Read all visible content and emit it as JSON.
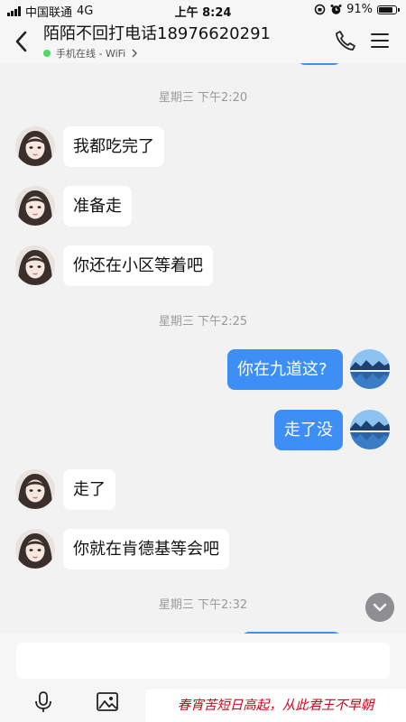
{
  "status_bar": {
    "carrier": "中国联通",
    "network": "4G",
    "time": "上午 8:24",
    "battery": "91%",
    "battery_level": 0.91
  },
  "header": {
    "title": "陌陌不回打电话18976620291",
    "presence": "手机在线 - WiFi"
  },
  "messages": [
    {
      "type": "time",
      "text": "星期三 下午2:20"
    },
    {
      "type": "in",
      "text": "我都吃完了"
    },
    {
      "type": "in",
      "text": "准备走"
    },
    {
      "type": "in",
      "text": "你还在小区等着吧"
    },
    {
      "type": "time",
      "text": "星期三 下午2:25"
    },
    {
      "type": "out",
      "text": "你在九道这?"
    },
    {
      "type": "out",
      "text": "走了没"
    },
    {
      "type": "in",
      "text": "走了"
    },
    {
      "type": "in",
      "text": "你就在肯德基等会吧"
    },
    {
      "type": "time",
      "text": "星期三 下午2:32"
    }
  ],
  "input": {
    "placeholder": ""
  },
  "banner": {
    "text": "春宵苦短日高起，从此君王不早朝"
  },
  "colors": {
    "accent": "#3d8ff5",
    "online": "#4cd964",
    "banner_text": "#d0021b"
  },
  "icons": [
    "back-icon",
    "phone-icon",
    "menu-icon",
    "scroll-down-icon",
    "microphone-icon",
    "image-icon"
  ]
}
